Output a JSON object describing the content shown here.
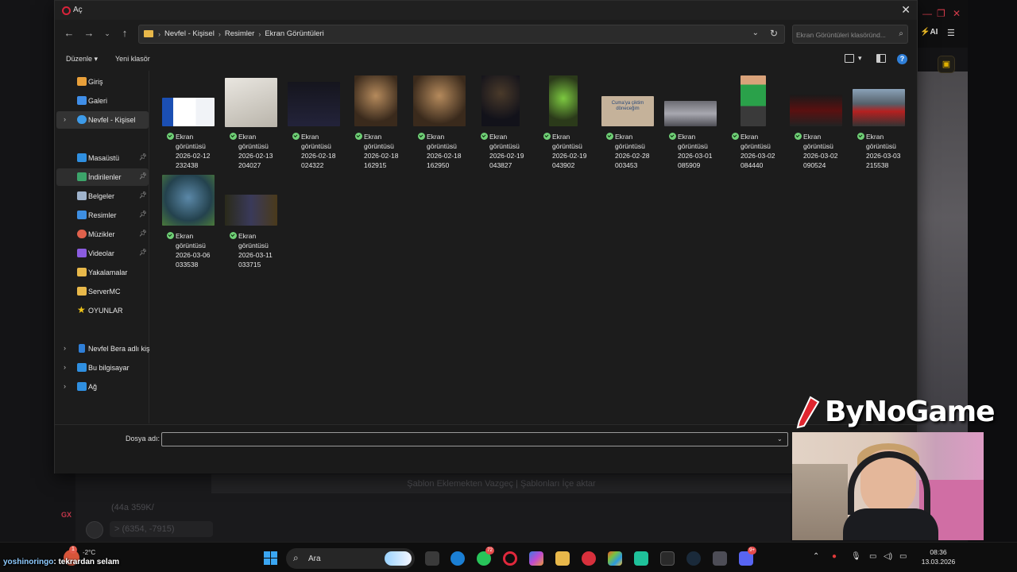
{
  "dialog": {
    "title": "Aç",
    "breadcrumbs": [
      "Nevfel - Kişisel",
      "Resimler",
      "Ekran Görüntüleri"
    ],
    "search_placeholder": "Ekran Görüntüleri klasöründ...",
    "commands": {
      "organize": "Düzenle",
      "new_folder": "Yeni klasör"
    },
    "filename_label": "Dosya adı:",
    "filename_value": ""
  },
  "sidebar": {
    "items": [
      {
        "label": "Giriş",
        "icon": "home-icon",
        "color": "#e9a03a"
      },
      {
        "label": "Galeri",
        "icon": "gallery-icon",
        "color": "#3f8ee8"
      },
      {
        "label": "Nevfel - Kişisel",
        "icon": "onedrive-icon",
        "color": "#3d9be9"
      },
      {
        "label": "Masaüstü",
        "icon": "desktop-icon",
        "color": "#2f8fe0"
      },
      {
        "label": "İndirilenler",
        "icon": "downloads-icon",
        "color": "#3ca46a"
      },
      {
        "label": "Belgeler",
        "icon": "documents-icon",
        "color": "#9fb3cc"
      },
      {
        "label": "Resimler",
        "icon": "pictures-icon",
        "color": "#3e8fe3"
      },
      {
        "label": "Müzikler",
        "icon": "music-icon",
        "color": "#e0614c"
      },
      {
        "label": "Videolar",
        "icon": "videos-icon",
        "color": "#8b5ce0"
      },
      {
        "label": "Yakalamalar",
        "icon": "folder-icon",
        "color": "#e8b84a"
      },
      {
        "label": "ServerMC",
        "icon": "folder-icon",
        "color": "#e8b84a"
      },
      {
        "label": "OYUNLAR",
        "icon": "star-icon",
        "color": "#f0c419"
      },
      {
        "label": "Nevfel Bera adlı kiş",
        "icon": "phone-icon",
        "color": "#2f7fd8"
      },
      {
        "label": "Bu bilgisayar",
        "icon": "computer-icon",
        "color": "#2f8fe0"
      },
      {
        "label": "Ağ",
        "icon": "network-icon",
        "color": "#2f8fe0"
      }
    ]
  },
  "files": [
    {
      "line1": "Ekran",
      "line2": "görüntüsü",
      "line3": "2026-02-12",
      "line4": "232438"
    },
    {
      "line1": "Ekran",
      "line2": "görüntüsü",
      "line3": "2026-02-13",
      "line4": "204027"
    },
    {
      "line1": "Ekran",
      "line2": "görüntüsü",
      "line3": "2026-02-18",
      "line4": "024322"
    },
    {
      "line1": "Ekran",
      "line2": "görüntüsü",
      "line3": "2026-02-18",
      "line4": "162915"
    },
    {
      "line1": "Ekran",
      "line2": "görüntüsü",
      "line3": "2026-02-18",
      "line4": "162950"
    },
    {
      "line1": "Ekran",
      "line2": "görüntüsü",
      "line3": "2026-02-19",
      "line4": "043827"
    },
    {
      "line1": "Ekran",
      "line2": "görüntüsü",
      "line3": "2026-02-19",
      "line4": "043902"
    },
    {
      "line1": "Ekran",
      "line2": "görüntüsü",
      "line3": "2026-02-28",
      "line4": "003453"
    },
    {
      "line1": "Ekran",
      "line2": "görüntüsü",
      "line3": "2026-03-01",
      "line4": "085909"
    },
    {
      "line1": "Ekran",
      "line2": "görüntüsü",
      "line3": "2026-03-02",
      "line4": "084440"
    },
    {
      "line1": "Ekran",
      "line2": "görüntüsü",
      "line3": "2026-03-02",
      "line4": "090524"
    },
    {
      "line1": "Ekran",
      "line2": "görüntüsü",
      "line3": "2026-03-03",
      "line4": "215538"
    },
    {
      "line1": "Ekran",
      "line2": "görüntüsü",
      "line3": "2026-03-06",
      "line4": "033538"
    },
    {
      "line1": "Ekran",
      "line2": "görüntüsü",
      "line3": "2026-03-11",
      "line4": "033715"
    }
  ],
  "thumbnail_texts": {
    "file8": "Cuma'ya çiktim döneceğim"
  },
  "background_app": {
    "template_bar": "Şablon Eklemekten Vazgeç | Şablonları İçe aktar",
    "coord_1": "(44a 359K/",
    "coord_2": "> (6354, -7915)",
    "ai_label": "AI",
    "gx_label": "GX"
  },
  "taskbar": {
    "weather_temp": "-2°C",
    "weather_badge": "1",
    "search_text": "Ara",
    "whatsapp_badge": "72",
    "discord_badge": "9+",
    "time": "08:36",
    "date": "13.03.2026"
  },
  "stream": {
    "chat_user": "yoshinoringo",
    "chat_message": ": tekrardan selam",
    "brand": "ByNoGame"
  }
}
